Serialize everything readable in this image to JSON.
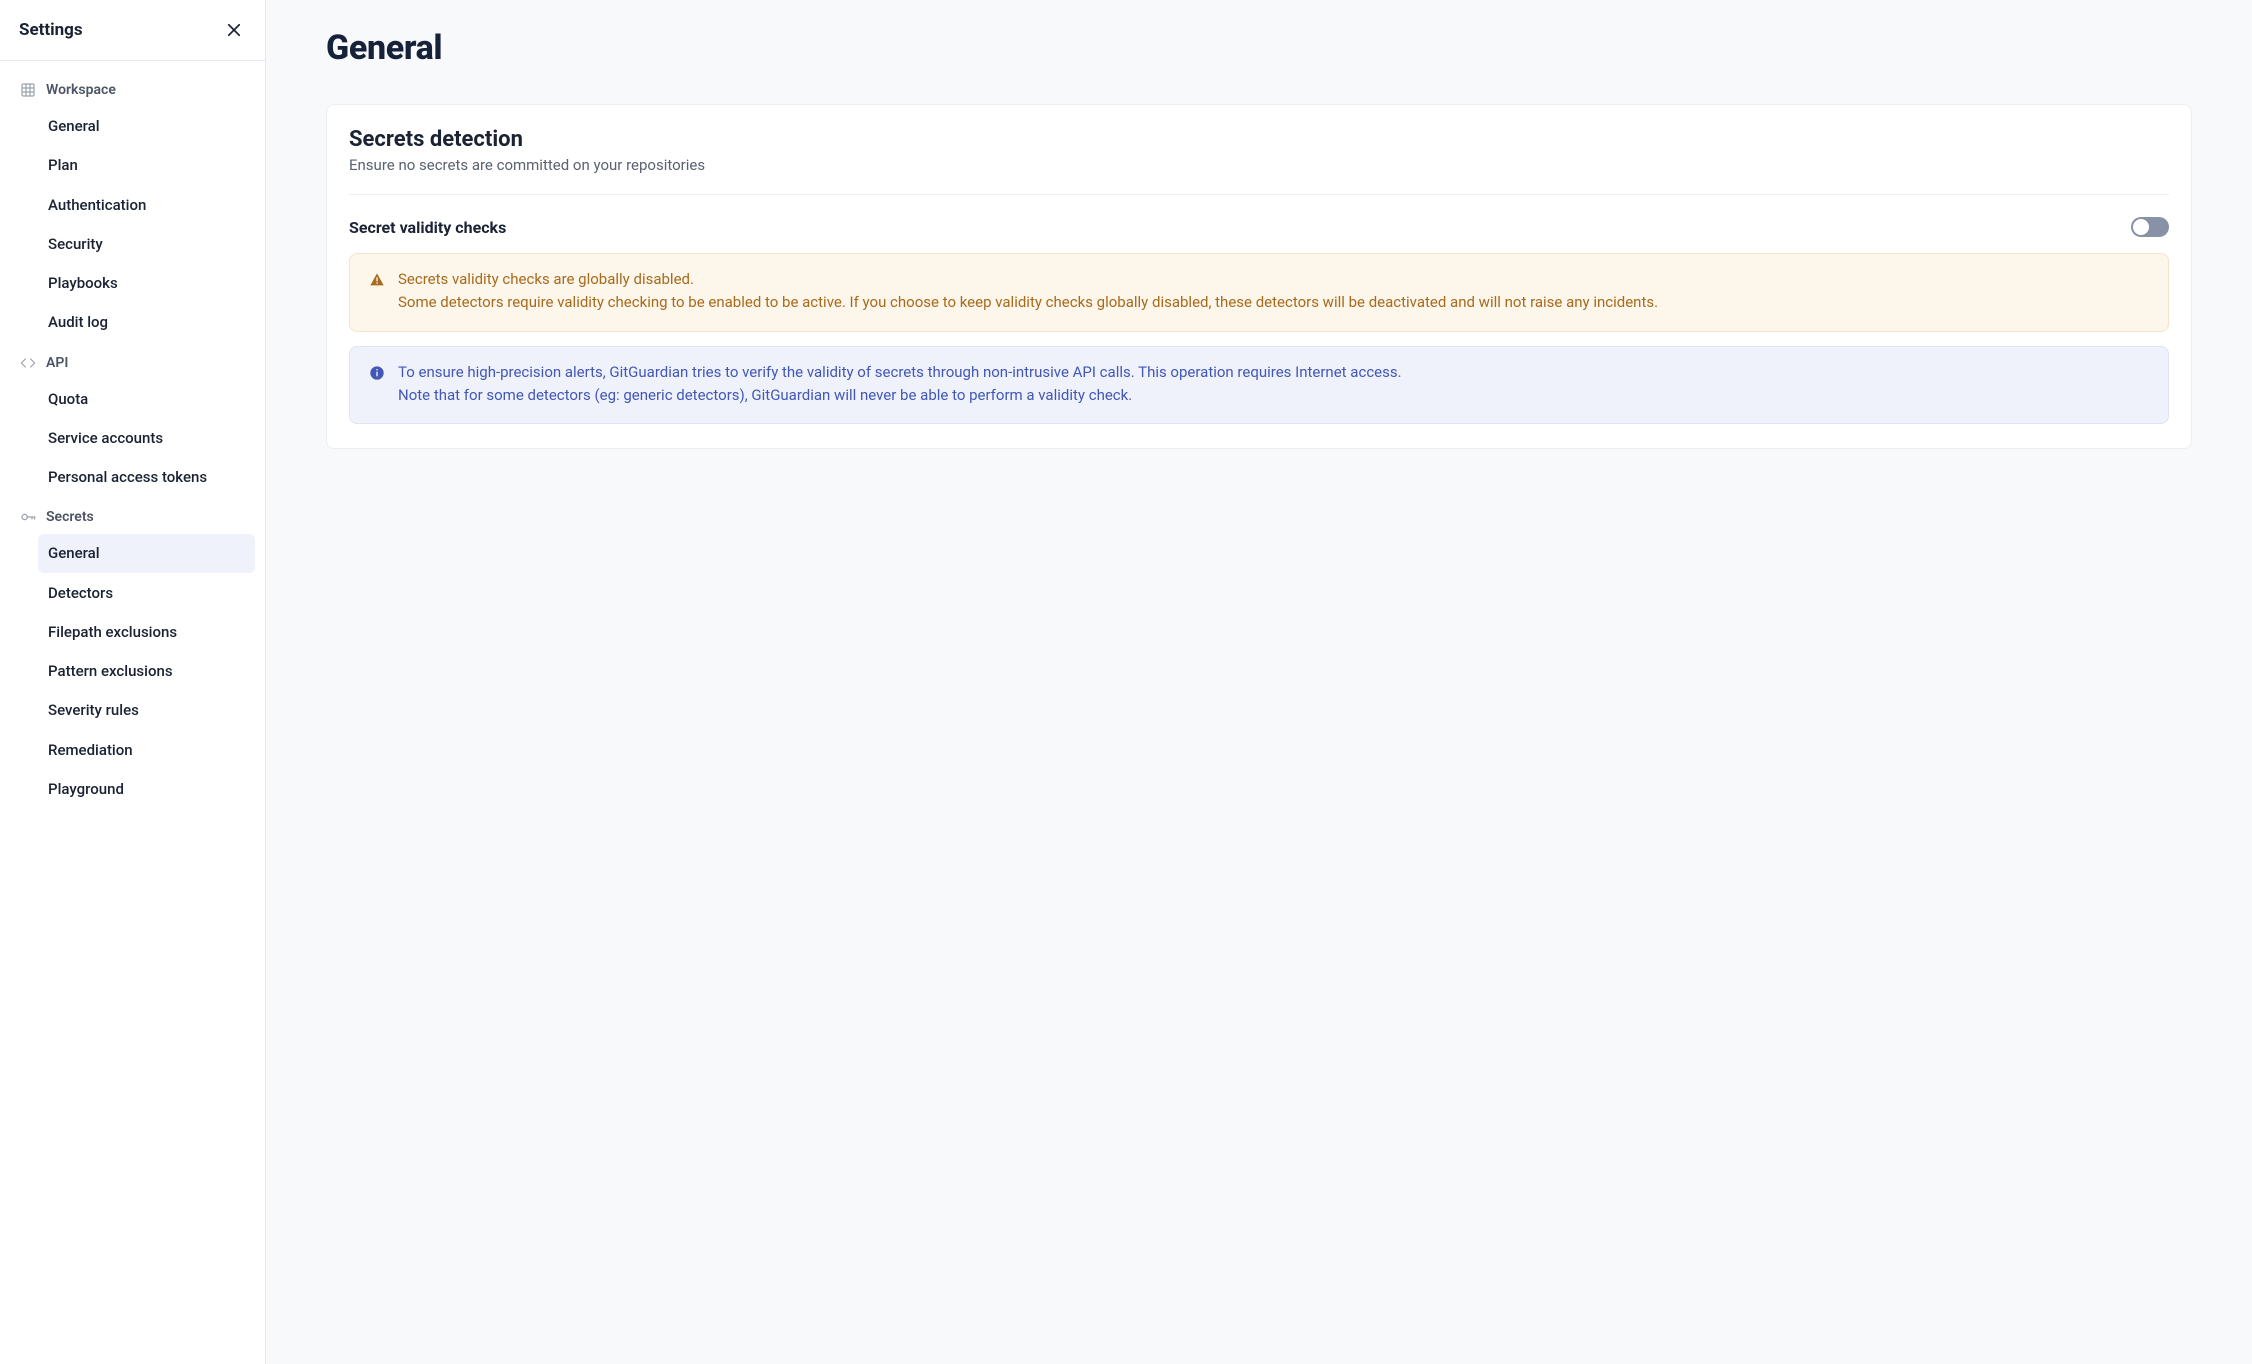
{
  "sidebar": {
    "title": "Settings",
    "sections": [
      {
        "label": "Workspace",
        "icon": "workspace-icon",
        "items": [
          "General",
          "Plan",
          "Authentication",
          "Security",
          "Playbooks",
          "Audit log"
        ]
      },
      {
        "label": "API",
        "icon": "api-icon",
        "items": [
          "Quota",
          "Service accounts",
          "Personal access tokens"
        ]
      },
      {
        "label": "Secrets",
        "icon": "secrets-icon",
        "items": [
          "General",
          "Detectors",
          "Filepath exclusions",
          "Pattern exclusions",
          "Severity rules",
          "Remediation",
          "Playground"
        ]
      }
    ],
    "active": {
      "section": 2,
      "item": 0
    }
  },
  "main": {
    "title": "General",
    "card": {
      "title": "Secrets detection",
      "subtitle": "Ensure no secrets are committed on your repositories",
      "setting": {
        "label": "Secret validity checks",
        "enabled": false
      },
      "warning": {
        "line1": "Secrets validity checks are globally disabled.",
        "line2": "Some detectors require validity checking to be enabled to be active. If you choose to keep validity checks globally disabled, these detectors will be deactivated and will not raise any incidents."
      },
      "info": {
        "line1": "To ensure high-precision alerts, GitGuardian tries to verify the validity of secrets through non-intrusive API calls. This operation requires Internet access.",
        "line2": "Note that for some detectors (eg: generic detectors), GitGuardian will never be able to perform a validity check."
      }
    }
  }
}
